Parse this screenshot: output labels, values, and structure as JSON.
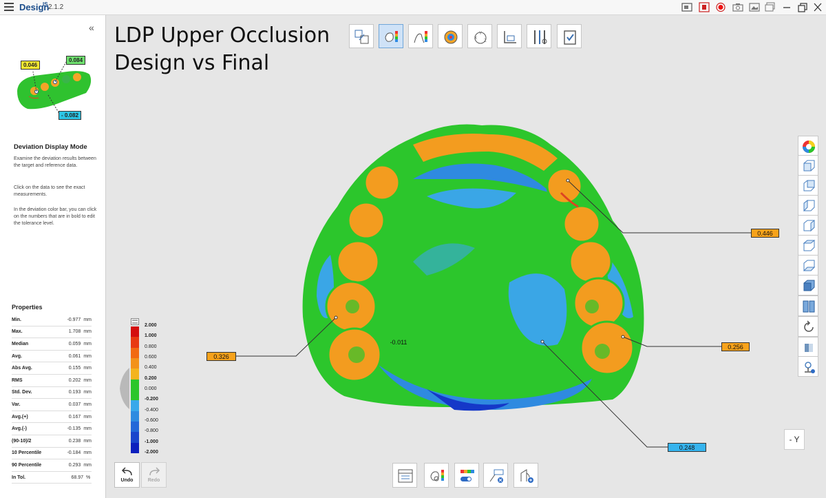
{
  "app": {
    "name": "Design",
    "superscript": "IS",
    "version": "2.1.2"
  },
  "left_panel": {
    "thumbnail_labels": {
      "top_left": "0.046",
      "top_right": "0.084",
      "bottom": "- 0.082"
    },
    "section_title": "Deviation Display Mode",
    "paragraphs": [
      "Examine the deviation results between the target and reference data.",
      "Click on the data to see the exact measurements.",
      "In the deviation color bar, you can click on the numbers that are in bold to edit the tolerance level."
    ],
    "properties_title": "Properties",
    "properties": [
      {
        "label": "Min.",
        "value": "-0.977",
        "unit": "mm"
      },
      {
        "label": "Max.",
        "value": "1.708",
        "unit": "mm"
      },
      {
        "label": "Median",
        "value": "0.059",
        "unit": "mm"
      },
      {
        "label": "Avg.",
        "value": "0.061",
        "unit": "mm"
      },
      {
        "label": "Abs Avg.",
        "value": "0.155",
        "unit": "mm"
      },
      {
        "label": "RMS",
        "value": "0.202",
        "unit": "mm"
      },
      {
        "label": "Std. Dev.",
        "value": "0.193",
        "unit": "mm"
      },
      {
        "label": "Var.",
        "value": "0.037",
        "unit": "mm"
      },
      {
        "label": "Avg.(+)",
        "value": "0.167",
        "unit": "mm"
      },
      {
        "label": "Avg.(-)",
        "value": "-0.135",
        "unit": "mm"
      },
      {
        "label": "(90-10)/2",
        "value": "0.238",
        "unit": "mm"
      },
      {
        "label": "10 Percentile",
        "value": "-0.184",
        "unit": "mm"
      },
      {
        "label": "90 Percentile",
        "value": "0.293",
        "unit": "mm"
      },
      {
        "label": "In Tol.",
        "value": "68.97",
        "unit": "%"
      }
    ]
  },
  "main": {
    "title_line1": "LDP Upper Occlusion",
    "title_line2": "Design vs Final",
    "center_label": "-0.011",
    "callouts": {
      "upper_right": "0.446",
      "left": "0.326",
      "right": "0.256",
      "bottom": "0.248"
    },
    "view_label": "- Y"
  },
  "color_scale": {
    "ticks": [
      "2.000",
      "1.000",
      "0.800",
      "0.600",
      "0.400",
      "0.200",
      "0.000",
      "-0.200",
      "-0.400",
      "-0.600",
      "-0.800",
      "-1.000",
      "-2.000"
    ],
    "bold_ticks": [
      "2.000",
      "1.000",
      "0.200",
      "-0.200",
      "-1.000",
      "-2.000"
    ],
    "colors": [
      "#d40f0f",
      "#e83a12",
      "#f26a12",
      "#f3921a",
      "#f4b41f",
      "#2bc62b",
      "#2bc62b",
      "#38a8ea",
      "#2e8be0",
      "#2368d8",
      "#1a45cc",
      "#0c1fbd"
    ]
  },
  "bottom_toolbar": {
    "undo_label": "Undo",
    "redo_label": "Redo"
  },
  "colors": {
    "accent": "#1a4c8b",
    "callout_orange": "#f7a21b",
    "callout_blue": "#36b4ee",
    "within_tolerance": "#2bc62b"
  }
}
